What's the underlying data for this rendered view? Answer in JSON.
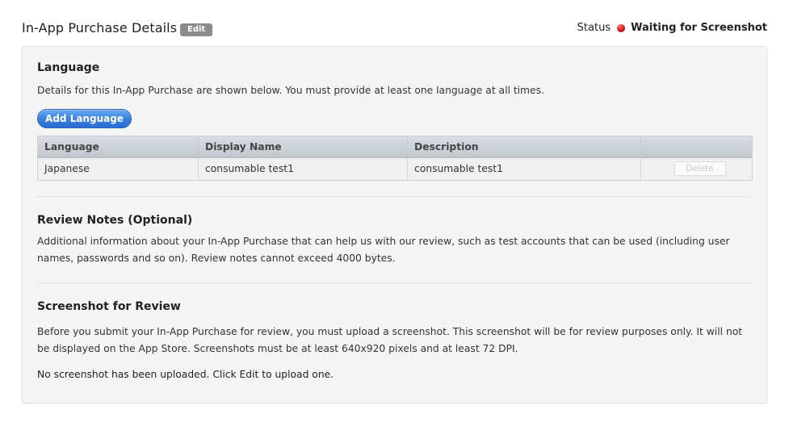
{
  "header": {
    "title": "In-App Purchase Details",
    "edit_label": "Edit",
    "status_label": "Status",
    "status_value": "Waiting for Screenshot",
    "status_color": "#e02020"
  },
  "language": {
    "title": "Language",
    "description": "Details for this In-App Purchase are shown below. You must provide at least one language at all times.",
    "add_button": "Add Language",
    "columns": [
      "Language",
      "Display Name",
      "Description",
      ""
    ],
    "rows": [
      {
        "language": "Japanese",
        "display_name": "consumable test1",
        "description": "consumable test1",
        "action": "Delete"
      }
    ]
  },
  "review_notes": {
    "title": "Review Notes (Optional)",
    "description": "Additional information about your In-App Purchase that can help us with our review, such as test accounts that can be used (including user names, passwords and so on). Review notes cannot exceed 4000 bytes."
  },
  "screenshot": {
    "title": "Screenshot for Review",
    "description": "Before you submit your In-App Purchase for review, you must upload a screenshot. This screenshot will be for review purposes only. It will not be displayed on the App Store. Screenshots must be at least 640x920 pixels and at least 72 DPI.",
    "empty_message": "No screenshot has been uploaded. Click Edit to upload one."
  },
  "colors": {
    "accent": "#3b82de",
    "panel_bg": "#f5f5f5",
    "table_header": "#c9ced6"
  }
}
